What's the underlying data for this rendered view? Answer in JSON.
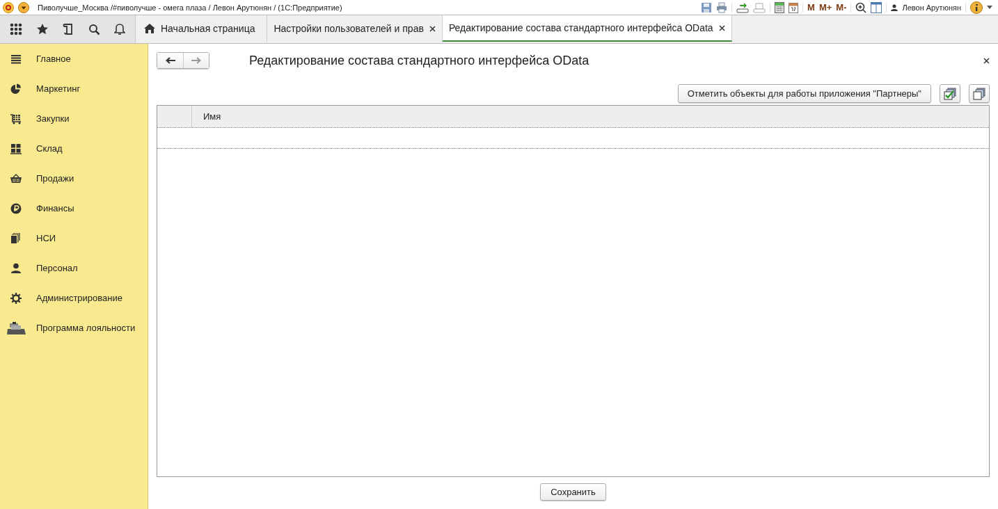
{
  "window": {
    "title": "Пиволучше_Москва /#пиволучше - омега плаза / Левон Арутюнян /   (1С:Предприятие)",
    "memory_buttons": [
      "M",
      "M+",
      "M-"
    ],
    "user": "Левон Арутюнян"
  },
  "tabs": [
    {
      "label": "Начальная страница",
      "kind": "home",
      "selected": false,
      "closable": false
    },
    {
      "label": "Настройки пользователей и прав",
      "kind": "plain",
      "selected": false,
      "closable": true
    },
    {
      "label": "Редактирование состава стандартного интерфейса OData",
      "kind": "plain",
      "selected": true,
      "closable": true
    }
  ],
  "sidebar": {
    "items": [
      {
        "label": "Главное",
        "kind": "menu"
      },
      {
        "label": "Маркетинг",
        "kind": "pie"
      },
      {
        "label": "Закупки",
        "kind": "cart"
      },
      {
        "label": "Склад",
        "kind": "grid"
      },
      {
        "label": "Продажи",
        "kind": "basket"
      },
      {
        "label": "Финансы",
        "kind": "ruble"
      },
      {
        "label": "НСИ",
        "kind": "pages"
      },
      {
        "label": "Персонал",
        "kind": "person"
      },
      {
        "label": "Администрирование",
        "kind": "gear"
      },
      {
        "label": "Программа лояльности",
        "kind": "register"
      }
    ]
  },
  "form": {
    "title": "Редактирование состава стандартного интерфейса OData",
    "command": "Отметить объекты для работы приложения \"Партнеры\"",
    "table": {
      "columns": [
        "Имя"
      ]
    },
    "save_button": "Сохранить"
  }
}
